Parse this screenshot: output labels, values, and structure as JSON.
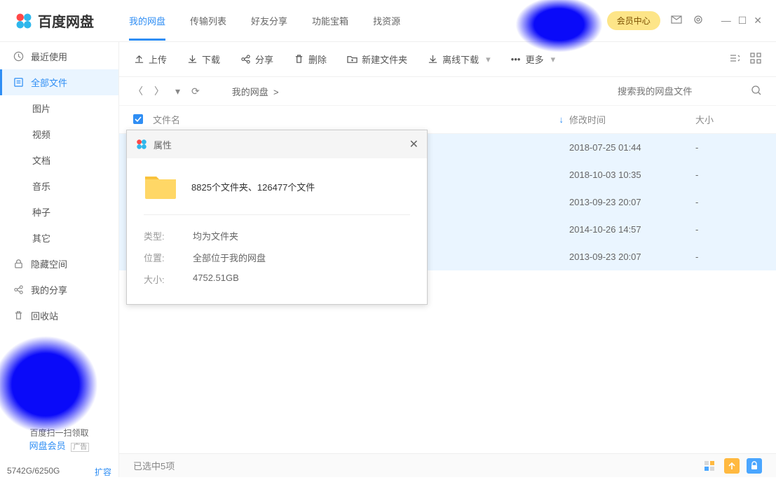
{
  "header": {
    "app_title": "百度网盘",
    "tabs": [
      "我的网盘",
      "传输列表",
      "好友分享",
      "功能宝箱",
      "找资源"
    ],
    "vip_label": "会员中心"
  },
  "toolbar": {
    "upload": "上传",
    "download": "下载",
    "share": "分享",
    "delete": "删除",
    "new_folder": "新建文件夹",
    "offline": "离线下载",
    "more": "更多"
  },
  "sidebar": {
    "recent": "最近使用",
    "all_files": "全部文件",
    "subs": [
      "图片",
      "视频",
      "文档",
      "音乐",
      "种子",
      "其它"
    ],
    "hidden": "隐藏空间",
    "my_share": "我的分享",
    "recycle": "回收站",
    "qr_line1": "百度扫一扫领取",
    "qr_line2": "网盘会员",
    "ad_tag": "广告",
    "storage_text": "5742G/6250G",
    "expand": "扩容"
  },
  "path": {
    "breadcrumb": "我的网盘",
    "sep": ">"
  },
  "search": {
    "placeholder": "搜索我的网盘文件"
  },
  "table": {
    "headers": {
      "name": "文件名",
      "time": "修改时间",
      "size": "大小"
    },
    "rows": [
      {
        "time": "2018-07-25 01:44",
        "size": "-"
      },
      {
        "time": "2018-10-03 10:35",
        "size": "-"
      },
      {
        "time": "2013-09-23 20:07",
        "size": "-"
      },
      {
        "time": "2014-10-26 14:57",
        "size": "-"
      },
      {
        "time": "2013-09-23 20:07",
        "size": "-"
      }
    ]
  },
  "popup": {
    "title": "属性",
    "summary": "8825个文件夹、126477个文件",
    "type_label": "类型:",
    "type_value": "均为文件夹",
    "loc_label": "位置:",
    "loc_value": "全部位于我的网盘",
    "size_label": "大小:",
    "size_value": "4752.51GB"
  },
  "footer": {
    "status": "已选中5项"
  }
}
